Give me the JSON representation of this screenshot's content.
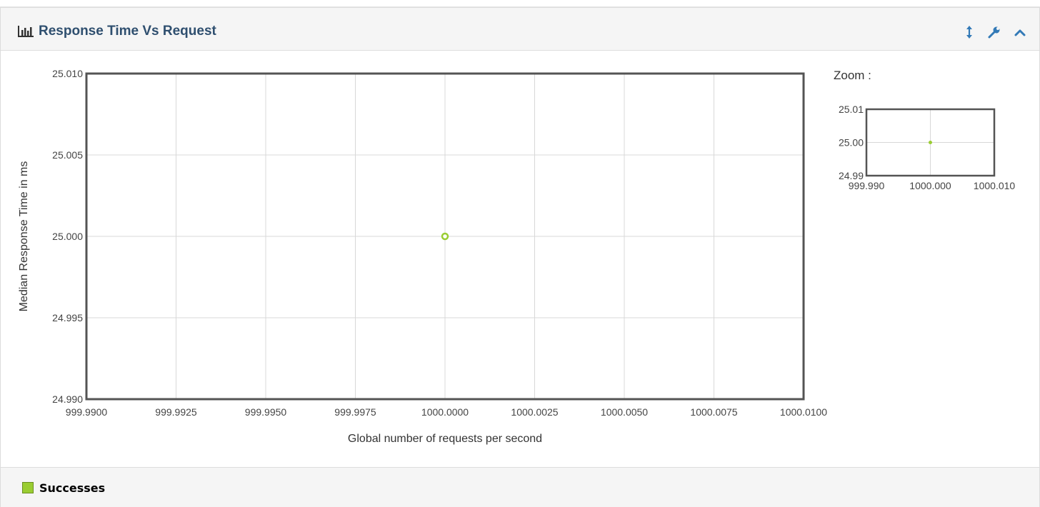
{
  "panel": {
    "title": "Response Time Vs Request",
    "title_icon": "bar-chart-icon",
    "tools": [
      {
        "name": "resize-icon"
      },
      {
        "name": "wrench-icon"
      },
      {
        "name": "chevron-up-icon"
      }
    ],
    "accent_color": "#337ab7",
    "title_color": "#2f4f6f"
  },
  "zoom": {
    "label": "Zoom :"
  },
  "legend": {
    "items": [
      {
        "label": "Successes",
        "color": "#9acd32"
      }
    ]
  },
  "chart_data": {
    "type": "scatter",
    "xlabel": "Global number of requests per second",
    "ylabel": "Median Response Time in ms",
    "xlim": [
      999.99,
      1000.01
    ],
    "ylim": [
      24.99,
      25.01
    ],
    "x_ticks": [
      "999.9900",
      "999.9925",
      "999.9950",
      "999.9975",
      "1000.0000",
      "1000.0025",
      "1000.0050",
      "1000.0075",
      "1000.0100"
    ],
    "y_ticks": [
      "25.010",
      "25.005",
      "25.000",
      "24.995",
      "24.990"
    ],
    "grid": true,
    "legend_position": "bottom-left",
    "series": [
      {
        "name": "Successes",
        "color": "#9acd32",
        "points": [
          {
            "x": 1000.0,
            "y": 25.0
          }
        ]
      }
    ],
    "zoom_chart": {
      "xlim": [
        999.99,
        1000.01
      ],
      "ylim": [
        24.99,
        25.01
      ],
      "x_ticks": [
        "999.990",
        "1000.000",
        "1000.010"
      ],
      "y_ticks": [
        "25.01",
        "25.00",
        "24.99"
      ]
    }
  }
}
